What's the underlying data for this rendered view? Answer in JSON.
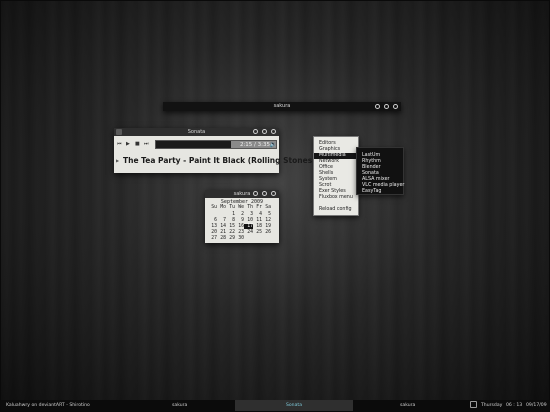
{
  "terminal_bar": {
    "title": "sakura"
  },
  "sonata": {
    "title": "Sonata",
    "controls": {
      "prev": "⏮",
      "play": "▶",
      "stop": "■",
      "next": "⏭"
    },
    "progress_text": "2:15 / 3:35",
    "progress": 0.628,
    "song": "The Tea Party - Paint It Black (Rolling Stones Cover)",
    "expander": "▶",
    "volume_icon": "speaker-icon"
  },
  "calendar": {
    "title": "sakura",
    "month": "September 2009",
    "weekdays": [
      "Su",
      "Mo",
      "Tu",
      "We",
      "Th",
      "Fr",
      "Sa"
    ],
    "weeks": [
      [
        "",
        "",
        "1",
        "2",
        "3",
        "4",
        "5"
      ],
      [
        "6",
        "7",
        "8",
        "9",
        "10",
        "11",
        "12"
      ],
      [
        "13",
        "14",
        "15",
        "16",
        "17",
        "18",
        "19"
      ],
      [
        "20",
        "21",
        "22",
        "23",
        "24",
        "25",
        "26"
      ],
      [
        "27",
        "28",
        "29",
        "30",
        "",
        "",
        ""
      ]
    ],
    "today": "17"
  },
  "menu": {
    "items": [
      "Editors",
      "Graphics",
      "Multimedia",
      "Network",
      "Office",
      "Shells",
      "System",
      "Scrot",
      "Exer Styles",
      "Fluxbox menu",
      "",
      "Reload config"
    ],
    "selected": "Multimedia",
    "submenu": [
      "LastUm",
      "Rhythm",
      "Blender",
      "Sonata",
      "ALSA mixer",
      "VLC media player",
      "EasyTag"
    ]
  },
  "taskbar": {
    "credit": "Kaluahwry on deviantART - Shirotino",
    "tasks": [
      "sakura",
      "Sonata",
      "sakura"
    ],
    "active_task": "Sonata",
    "day": "Thursday",
    "time": "06 : 13",
    "date": "09/17/09"
  }
}
